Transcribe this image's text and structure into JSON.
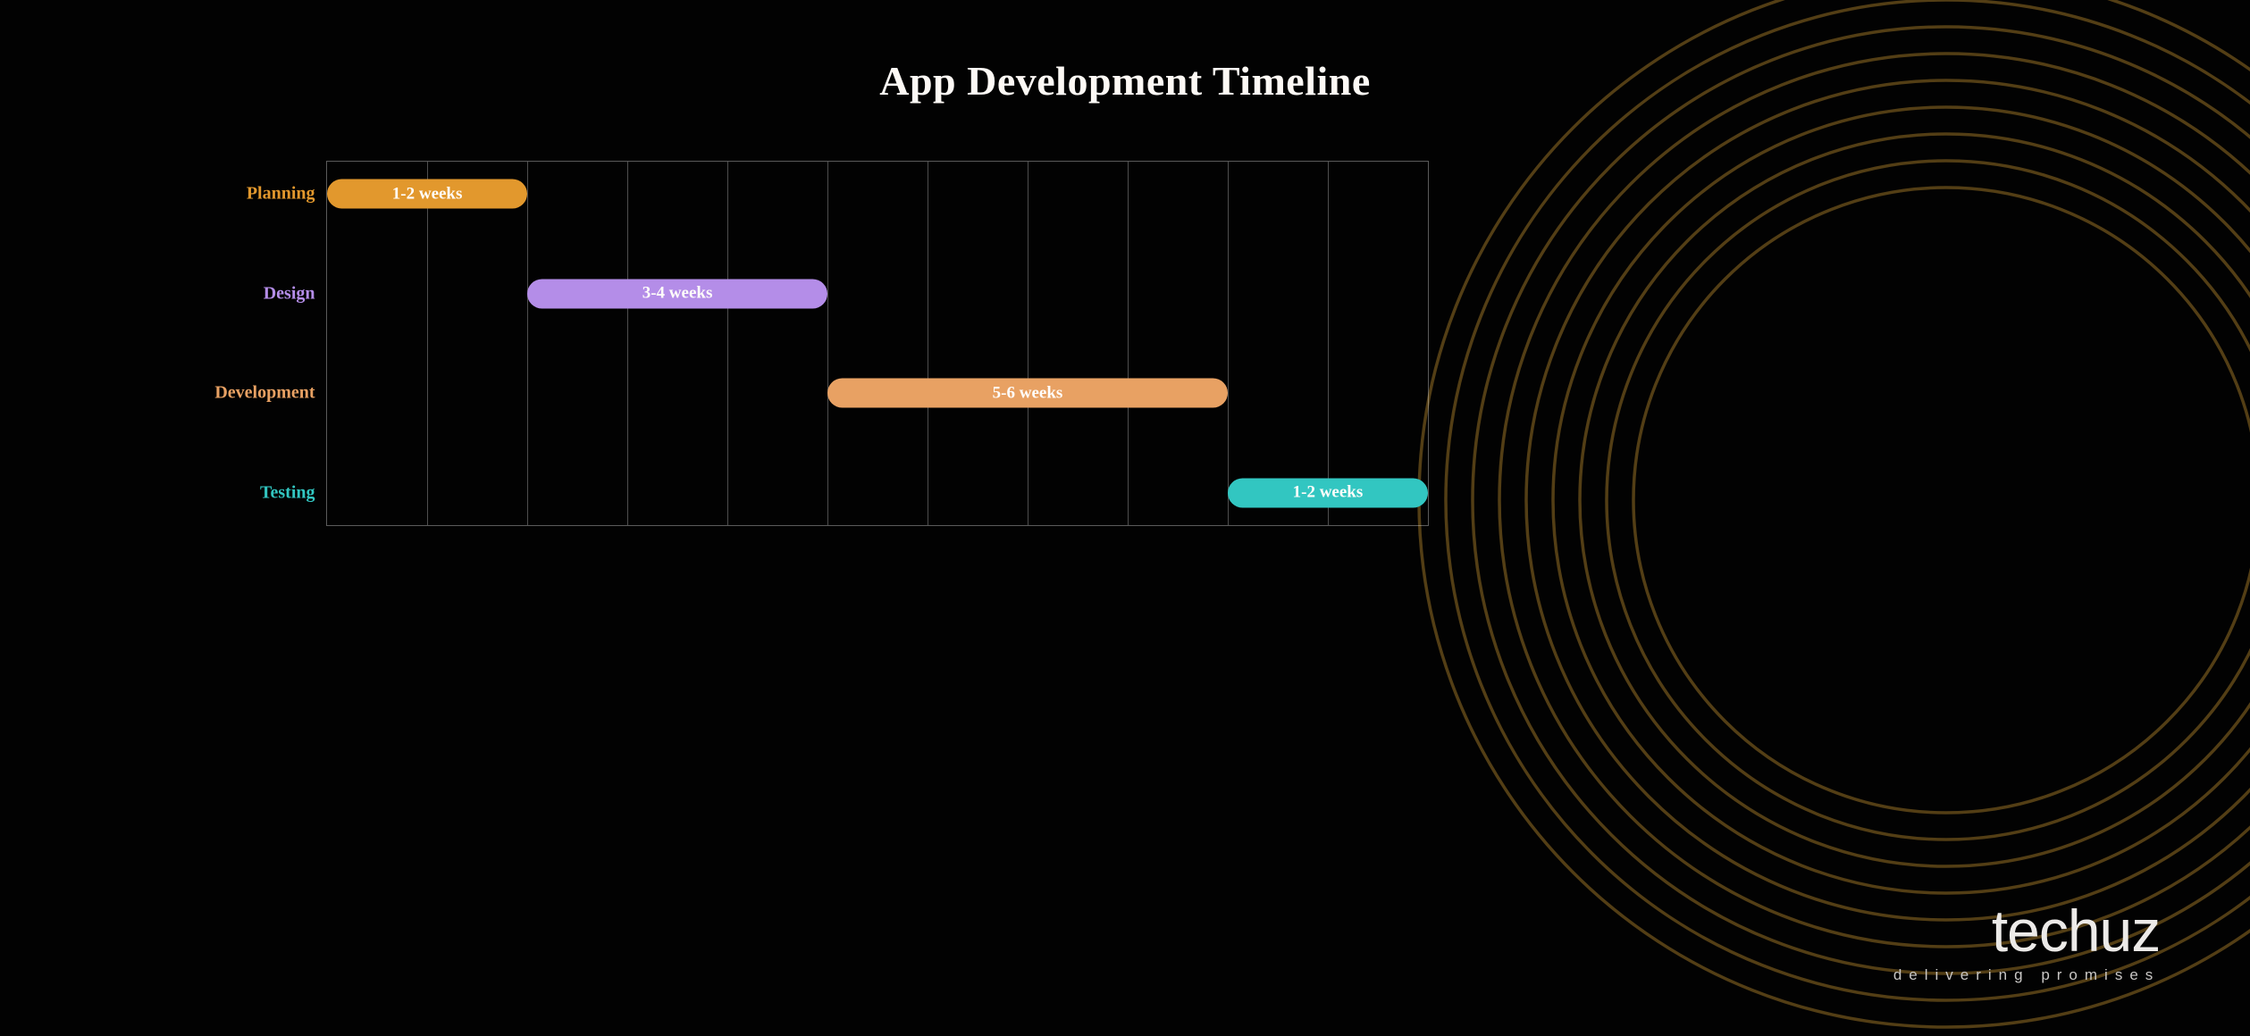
{
  "title": "App Development Timeline",
  "logo": {
    "name": "techuz",
    "tagline": "delivering promises"
  },
  "chart_data": {
    "type": "bar",
    "orientation": "horizontal-gantt",
    "title": "App Development Timeline",
    "xlabel": "",
    "ylabel": "",
    "grid": {
      "columns": 11,
      "vertical_lines": true,
      "horizontal_lines": false
    },
    "x_unit": "weeks",
    "series": [
      {
        "name": "Planning",
        "label": "1-2 weeks",
        "start": 0,
        "span": 2,
        "duration_weeks_min": 1,
        "duration_weeks_max": 2,
        "color": "#e2982d"
      },
      {
        "name": "Design",
        "label": "3-4 weeks",
        "start": 2,
        "span": 3,
        "duration_weeks_min": 3,
        "duration_weeks_max": 4,
        "color": "#b48de8"
      },
      {
        "name": "Development",
        "label": "5-6 weeks",
        "start": 5,
        "span": 4,
        "duration_weeks_min": 5,
        "duration_weeks_max": 6,
        "color": "#e8a163"
      },
      {
        "name": "Testing",
        "label": "1-2 weeks",
        "start": 9,
        "span": 2,
        "duration_weeks_min": 1,
        "duration_weeks_max": 2,
        "color": "#32c6c1"
      }
    ]
  }
}
